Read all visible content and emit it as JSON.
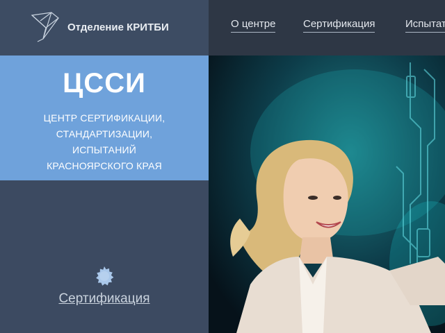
{
  "brand": {
    "name": "Отделение КРИТБИ",
    "logo_icon": "bird-logo-icon"
  },
  "nav": {
    "items": [
      {
        "label": "О центре"
      },
      {
        "label": "Сертификация"
      },
      {
        "label": "Испытательная лаборатория"
      }
    ]
  },
  "hero": {
    "title": "ЦССИ",
    "lines": [
      "ЦЕНТР СЕРТИФИКАЦИИ,",
      "СТАНДАРТИЗАЦИИ,",
      "ИСПЫТАНИЙ",
      "КРАСНОЯРСКОГО КРАЯ"
    ]
  },
  "section": {
    "icon": "certificate-seal-icon",
    "link_label": "Сертификация"
  },
  "colors": {
    "brand_bg": "#3d4c63",
    "nav_bg": "#2e3745",
    "hero_box_bg": "#6fa2db",
    "lower_panel_bg": "#3c4a61",
    "seal_color": "#a9c7ea"
  }
}
